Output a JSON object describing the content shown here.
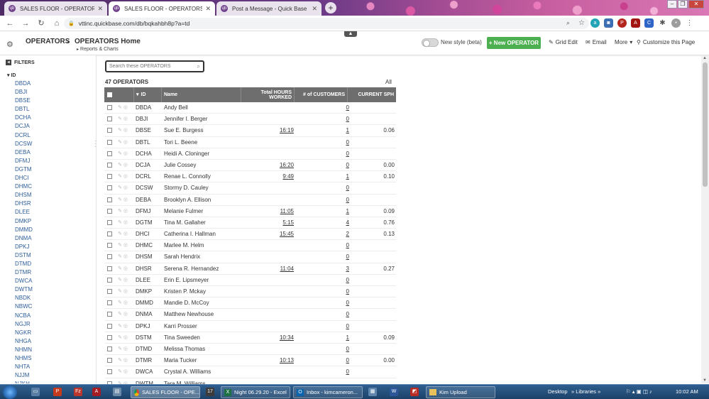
{
  "browser": {
    "tabs": [
      {
        "title": "SALES FLOOR - OPERATORS Ho",
        "active": false
      },
      {
        "title": "SALES FLOOR - OPERATORS Ho",
        "active": true
      },
      {
        "title": "Post a Message - Quick Base Co",
        "active": false
      }
    ],
    "url": "vttinc.quickbase.com/db/bqkahbh8p?a=td"
  },
  "header": {
    "root": "OPERATORS",
    "separator": "›",
    "page_title": "OPERATORS Home",
    "reports_link": "Reports & Charts",
    "toggle_label": "New style (beta)",
    "new_button": "+ New OPERATOR",
    "grid_edit": "Grid Edit",
    "email": "Email",
    "more": "More",
    "customize": "Customize this Page"
  },
  "sidebar": {
    "title": "FILTERS",
    "field": "ID",
    "items": [
      "DBDA",
      "DBJI",
      "DBSE",
      "DBTL",
      "DCHA",
      "DCJA",
      "DCRL",
      "DCSW",
      "DEBA",
      "DFMJ",
      "DGTM",
      "DHCI",
      "DHMC",
      "DHSM",
      "DHSR",
      "DLEE",
      "DMKP",
      "DMMD",
      "DNMA",
      "DPKJ",
      "DSTM",
      "DTMD",
      "DTMR",
      "DWCA",
      "DWTM",
      "NBDK",
      "NBWC",
      "NCBA",
      "NGJR",
      "NGKR",
      "NHGA",
      "NHMN",
      "NHMS",
      "NHTA",
      "NJJM",
      "NJKH"
    ]
  },
  "main": {
    "search_placeholder": "Search these OPERATORS",
    "count_label": "47 OPERATORS",
    "all_link": "All",
    "columns": {
      "id": "ID",
      "name": "Name",
      "hours": "Total HOURS WORKED",
      "customers": "# of CUSTOMERS",
      "sph": "CURRENT SPH"
    },
    "rows": [
      {
        "id": "DBDA",
        "name": "Andy Bell",
        "hours": "",
        "customers": "0",
        "sph": ""
      },
      {
        "id": "DBJI",
        "name": "Jennifer I. Berger",
        "hours": "",
        "customers": "0",
        "sph": ""
      },
      {
        "id": "DBSE",
        "name": "Sue E. Burgess",
        "hours": "16:19",
        "customers": "1",
        "sph": "0.06"
      },
      {
        "id": "DBTL",
        "name": "Tori L. Beene",
        "hours": "",
        "customers": "0",
        "sph": ""
      },
      {
        "id": "DCHA",
        "name": "Heidi A. Cloninger",
        "hours": "",
        "customers": "0",
        "sph": ""
      },
      {
        "id": "DCJA",
        "name": "Julie Cossey",
        "hours": "16:20",
        "customers": "0",
        "sph": "0.00"
      },
      {
        "id": "DCRL",
        "name": "Renae L. Connolly",
        "hours": "9:49",
        "customers": "1",
        "sph": "0.10"
      },
      {
        "id": "DCSW",
        "name": "Stormy D. Cauley",
        "hours": "",
        "customers": "0",
        "sph": ""
      },
      {
        "id": "DEBA",
        "name": "Brooklyn A. Ellison",
        "hours": "",
        "customers": "0",
        "sph": ""
      },
      {
        "id": "DFMJ",
        "name": "Melanie Fulmer",
        "hours": "11:05",
        "customers": "1",
        "sph": "0.09"
      },
      {
        "id": "DGTM",
        "name": "Tina M. Gallaher",
        "hours": "5:15",
        "customers": "4",
        "sph": "0.76"
      },
      {
        "id": "DHCI",
        "name": "Catherina I. Hallman",
        "hours": "15:45",
        "customers": "2",
        "sph": "0.13"
      },
      {
        "id": "DHMC",
        "name": "Marlee M. Helm",
        "hours": "",
        "customers": "0",
        "sph": ""
      },
      {
        "id": "DHSM",
        "name": "Sarah Hendrix",
        "hours": "",
        "customers": "0",
        "sph": ""
      },
      {
        "id": "DHSR",
        "name": "Serena R. Hernandez",
        "hours": "11:04",
        "customers": "3",
        "sph": "0.27"
      },
      {
        "id": "DLEE",
        "name": "Erin E. Lipsmeyer",
        "hours": "",
        "customers": "0",
        "sph": ""
      },
      {
        "id": "DMKP",
        "name": "Kristen P. Mckay",
        "hours": "",
        "customers": "0",
        "sph": ""
      },
      {
        "id": "DMMD",
        "name": "Mandie D. McCoy",
        "hours": "",
        "customers": "0",
        "sph": ""
      },
      {
        "id": "DNMA",
        "name": "Matthew Newhouse",
        "hours": "",
        "customers": "0",
        "sph": ""
      },
      {
        "id": "DPKJ",
        "name": "Karri Prosser",
        "hours": "",
        "customers": "0",
        "sph": ""
      },
      {
        "id": "DSTM",
        "name": "Tina Sweeden",
        "hours": "10:34",
        "customers": "1",
        "sph": "0.09"
      },
      {
        "id": "DTMD",
        "name": "Melissa Thomas",
        "hours": "",
        "customers": "0",
        "sph": ""
      },
      {
        "id": "DTMR",
        "name": "Maria Tucker",
        "hours": "10:13",
        "customers": "0",
        "sph": "0.00"
      },
      {
        "id": "DWCA",
        "name": "Crystal A. Williams",
        "hours": "",
        "customers": "0",
        "sph": ""
      },
      {
        "id": "DWTM",
        "name": "Tara M. Williams",
        "hours": "",
        "customers": "",
        "sph": ""
      }
    ]
  },
  "taskbar": {
    "tasks": [
      {
        "label": "SALES FLOOR - OPE...",
        "icon": "chrome-icon"
      },
      {
        "label": "Night 06.29.20 - Excel",
        "icon": "excel-icon"
      },
      {
        "label": "Inbox - kimcameron...",
        "icon": "outlook-icon"
      },
      {
        "label": "Kim Upload",
        "icon": "folder-icon"
      }
    ],
    "desktop": "Desktop",
    "libraries": "Libraries",
    "time": "10:02 AM"
  },
  "colors": {
    "accent_green": "#4caf50",
    "grid_header": "#6e6e6e",
    "filter_link": "#2d5d9a"
  }
}
